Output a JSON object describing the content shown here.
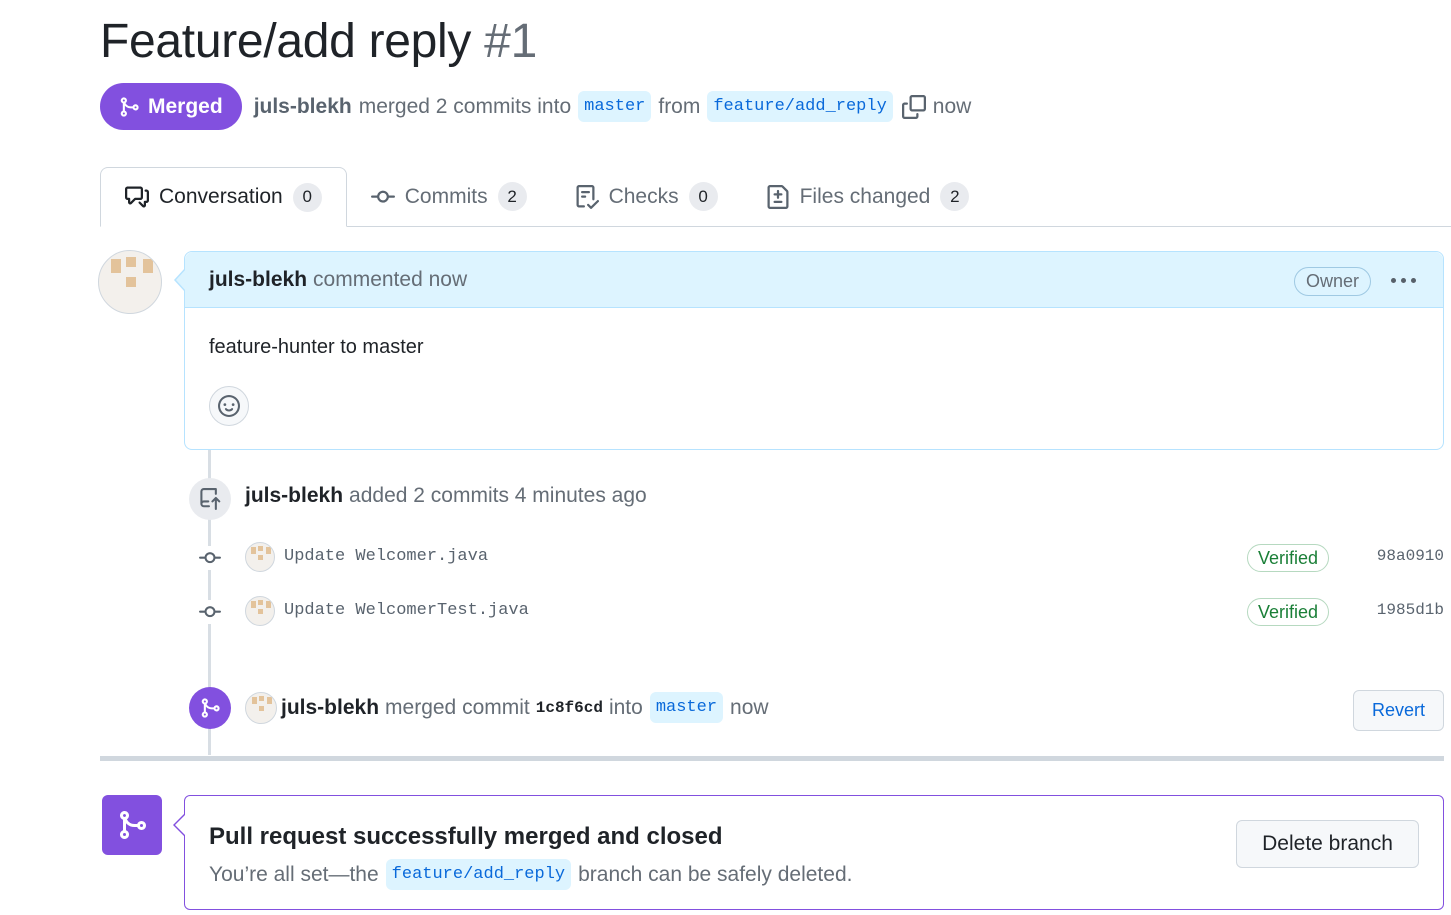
{
  "pr": {
    "title": "Feature/add reply",
    "number": "#1",
    "state_label": "Merged",
    "author": "juls-blekh",
    "merged_text": "merged 2 commits into",
    "base_branch": "master",
    "from_text": "from",
    "head_branch": "feature/add_reply",
    "time": "now"
  },
  "tabs": [
    {
      "label": "Conversation",
      "count": "0",
      "icon": "comment-discussion-icon"
    },
    {
      "label": "Commits",
      "count": "2",
      "icon": "git-commit-icon"
    },
    {
      "label": "Checks",
      "count": "0",
      "icon": "checklist-icon"
    },
    {
      "label": "Files changed",
      "count": "2",
      "icon": "file-diff-icon"
    }
  ],
  "comment": {
    "author": "juls-blekh",
    "meta": "commented now",
    "role_badge": "Owner",
    "body": "feature-hunter to master"
  },
  "commits_event": {
    "author": "juls-blekh",
    "text": "added 2 commits 4 minutes ago",
    "commits": [
      {
        "message": "Update Welcomer.java",
        "verified": "Verified",
        "sha": "98a0910"
      },
      {
        "message": "Update WelcomerTest.java",
        "verified": "Verified",
        "sha": "1985d1b"
      }
    ]
  },
  "merge_event": {
    "author": "juls-blekh",
    "text1": "merged commit",
    "sha": "1c8f6cd",
    "text2": "into",
    "branch": "master",
    "time": "now",
    "revert_label": "Revert"
  },
  "merge_box": {
    "title": "Pull request successfully merged and closed",
    "desc_prefix": "You’re all set—the",
    "branch": "feature/add_reply",
    "desc_suffix": "branch can be safely deleted.",
    "button_label": "Delete branch"
  },
  "colors": {
    "merged_purple": "#8250df",
    "link_blue": "#0969da",
    "verified_green": "#1a7f37",
    "comment_header_bg": "#ddf4ff"
  }
}
